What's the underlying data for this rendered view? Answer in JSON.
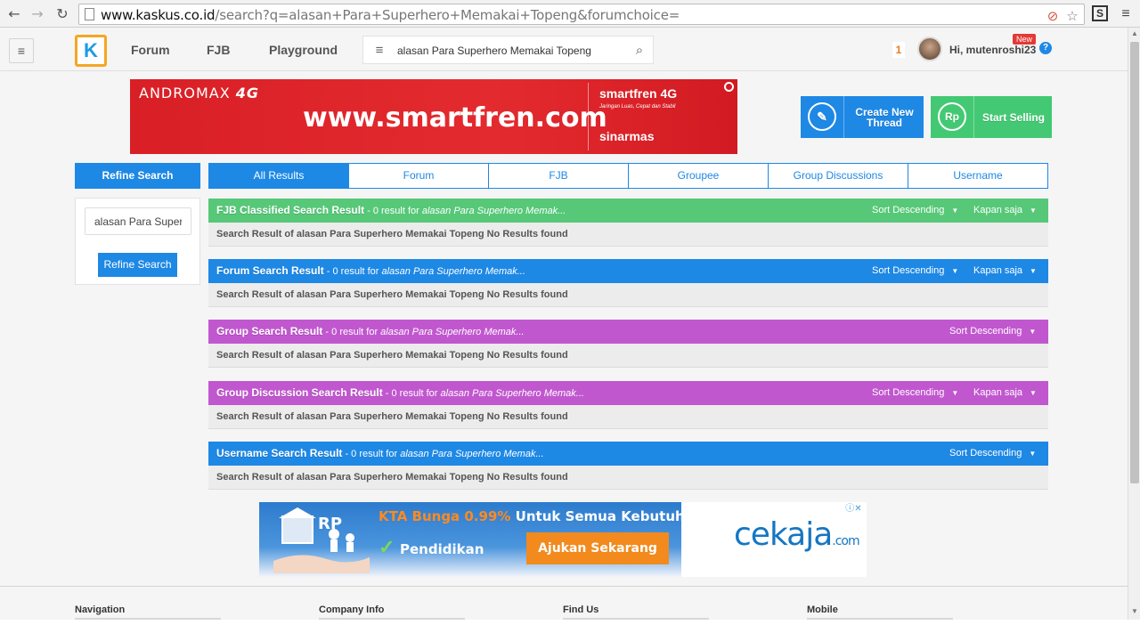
{
  "browser": {
    "back": "←",
    "forward": "→",
    "reload": "↻",
    "url_host": "www.kaskus.co.id",
    "url_path": "/search?q=alasan+Para+Superhero+Memakai+Topeng&forumchoice=",
    "star": "☆",
    "ext_label": "S",
    "menu": "≡"
  },
  "header": {
    "logo": "K",
    "nav": [
      "Forum",
      "FJB",
      "Playground"
    ],
    "search_value": "alasan Para Superhero Memakai Topeng",
    "notif_count": "1",
    "greeting": "Hi, mutenroshi23",
    "new_badge": "New",
    "help": "?"
  },
  "banner": {
    "tag_left": "ANDROMAX",
    "tag_right": "4G",
    "url": "www.smartfren.com",
    "brand": "smartfren 4G",
    "tagline": "Jaringan Luas, Cepat dan Stabil",
    "group": "sinarmas"
  },
  "actions": {
    "create": "Create New Thread",
    "sell": "Start Selling",
    "sell_symbol": "Rp",
    "create_symbol": "✎"
  },
  "refine": {
    "header": "Refine Search",
    "input_value": "alasan Para Superhero Memakai Topeng",
    "button": "Refine Search"
  },
  "tabs": [
    "All Results",
    "Forum",
    "FJB",
    "Groupee",
    "Group Discussions",
    "Username"
  ],
  "results": [
    {
      "title": "FJB Classified Search Result",
      "count_text": " - 0 result for ",
      "query": "alasan Para Superhero Memak...",
      "sort": "Sort Descending",
      "time": "Kapan saja",
      "body": "Search Result of alasan Para Superhero Memakai Topeng No Results found"
    },
    {
      "title": "Forum Search Result",
      "count_text": " - 0 result for ",
      "query": "alasan Para Superhero Memak...",
      "sort": "Sort Descending",
      "time": "Kapan saja",
      "body": "Search Result of alasan Para Superhero Memakai Topeng No Results found"
    },
    {
      "title": "Group Search Result",
      "count_text": " - 0 result for ",
      "query": "alasan Para Superhero Memak...",
      "sort": "Sort Descending",
      "time": "",
      "body": "Search Result of alasan Para Superhero Memakai Topeng No Results found"
    },
    {
      "title": "Group Discussion Search Result",
      "count_text": " - 0 result for ",
      "query": "alasan Para Superhero Memak...",
      "sort": "Sort Descending",
      "time": "Kapan saja",
      "body": "Search Result of alasan Para Superhero Memakai Topeng No Results found"
    },
    {
      "title": "Username Search Result",
      "count_text": " - 0 result for ",
      "query": "alasan Para Superhero Memak...",
      "sort": "Sort Descending",
      "time": "",
      "body": "Search Result of alasan Para Superhero Memakai Topeng No Results found"
    }
  ],
  "bottom_ad": {
    "headline_orange": "KTA Bunga 0.99%",
    "headline_white": " Untuk Semua Kebutuhan",
    "check": "✓",
    "edu": "Pendidikan",
    "cta": "Ajukan Sekarang >>",
    "brand": "cekaja",
    "brand_suffix": ".com",
    "adchoice": "ⓘ✕",
    "illus_text": "RP"
  },
  "footer": [
    "Navigation",
    "Company Info",
    "Find Us",
    "Mobile"
  ],
  "colors": {
    "primary": "#1e88e5",
    "green": "#56c878",
    "purple": "#c157cf",
    "accent": "#f5a623"
  }
}
